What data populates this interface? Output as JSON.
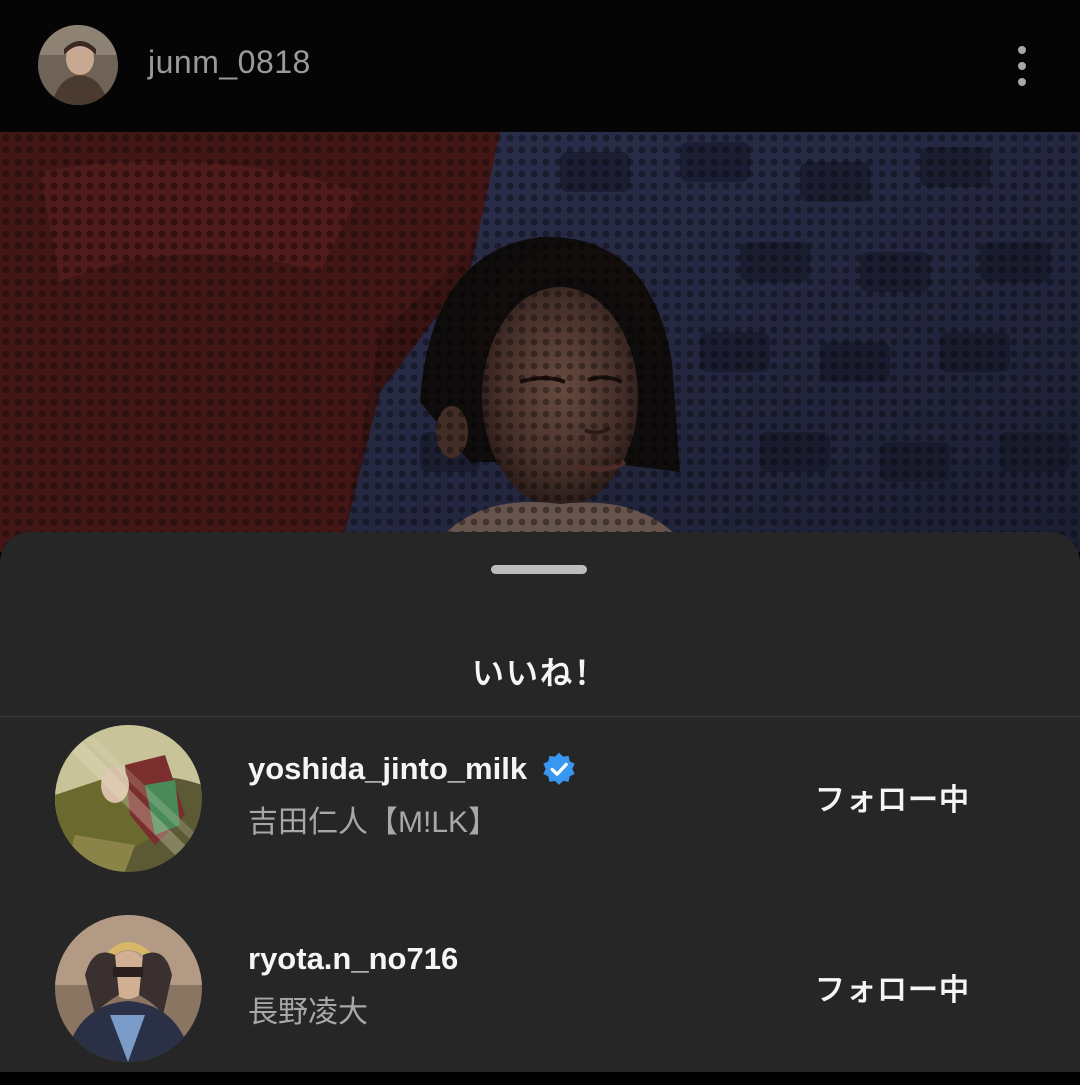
{
  "post": {
    "username": "junm_0818",
    "more_icon": "more-vertical-icon"
  },
  "sheet": {
    "title": "いいね！"
  },
  "likes": [
    {
      "handle": "yoshida_jinto_milk",
      "full_name": "吉田仁人【M!LK】",
      "verified": true,
      "button_label": "フォロー中"
    },
    {
      "handle": "ryota.n_no716",
      "full_name": "長野凌大",
      "verified": false,
      "button_label": "フォロー中"
    }
  ],
  "colors": {
    "sheet_background": "#262626",
    "verified_blue": "#3897f0",
    "secondary_text": "#a8a8a8"
  }
}
